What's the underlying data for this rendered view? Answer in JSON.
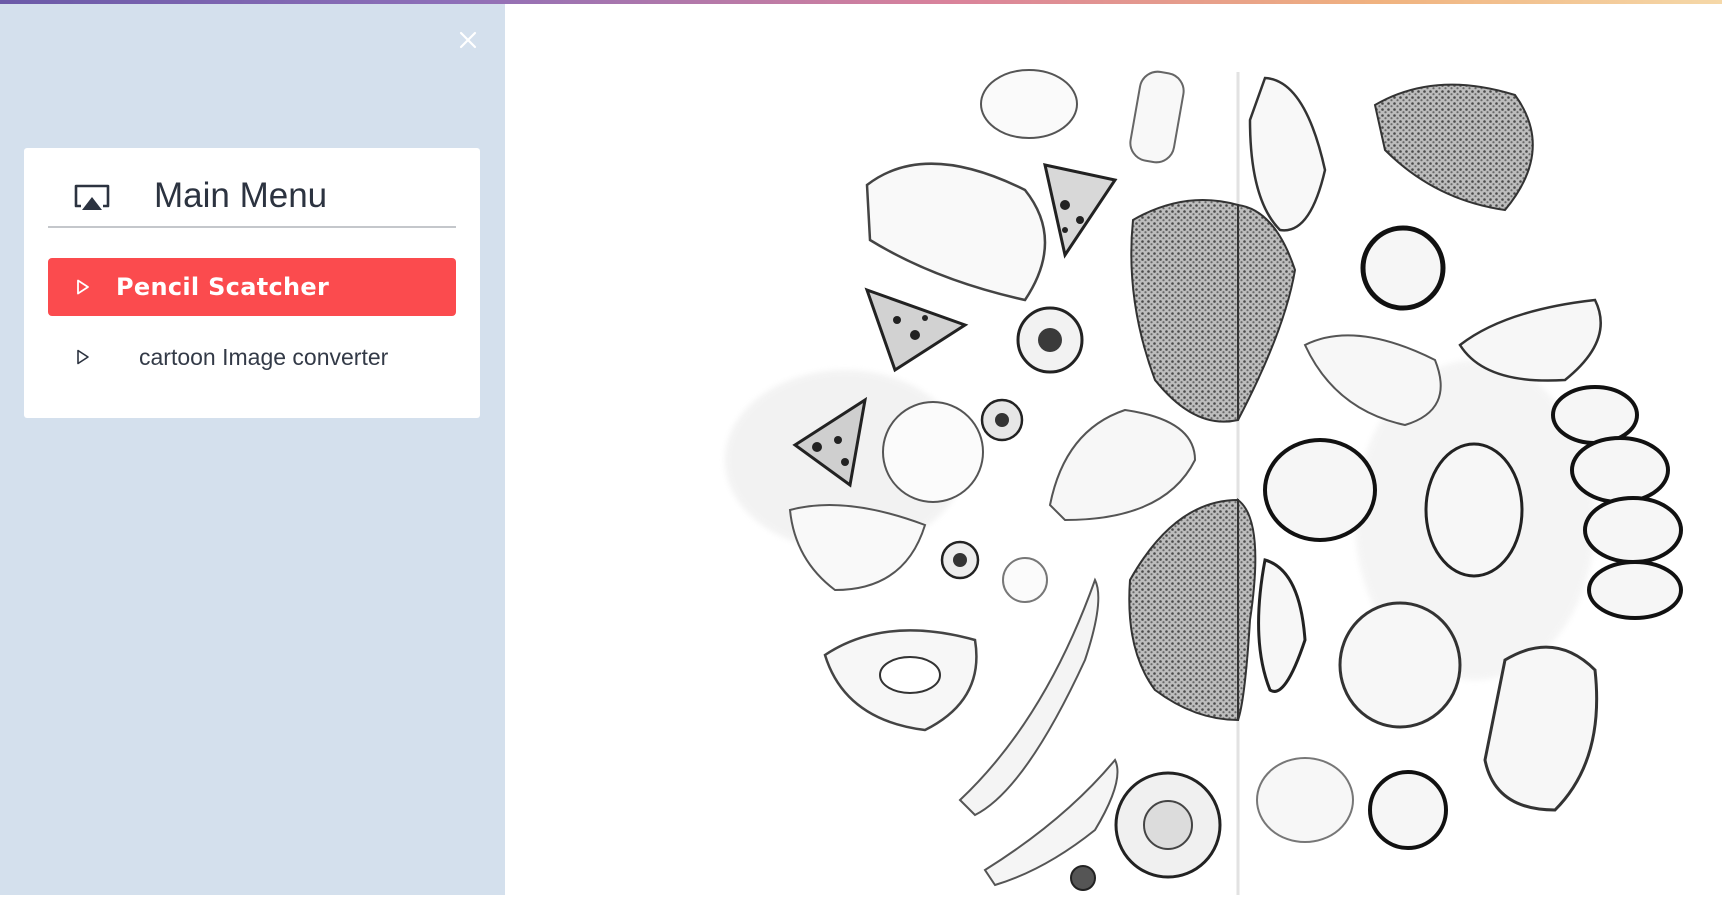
{
  "sidebar": {
    "close_icon": "close-icon",
    "menu": {
      "header_icon": "airplay-icon",
      "title": "Main Menu",
      "items": [
        {
          "label": "Pencil Scatcher",
          "active": true,
          "icon": "play-outline-icon"
        },
        {
          "label": "cartoon Image converter",
          "active": false,
          "icon": "play-outline-icon"
        }
      ]
    }
  },
  "colors": {
    "sidebar_bg": "#d4e0ed",
    "active_item": "#fb4b4e",
    "text": "#2c3340"
  },
  "main": {
    "image": "pencil-sketch-vegetables-image"
  }
}
